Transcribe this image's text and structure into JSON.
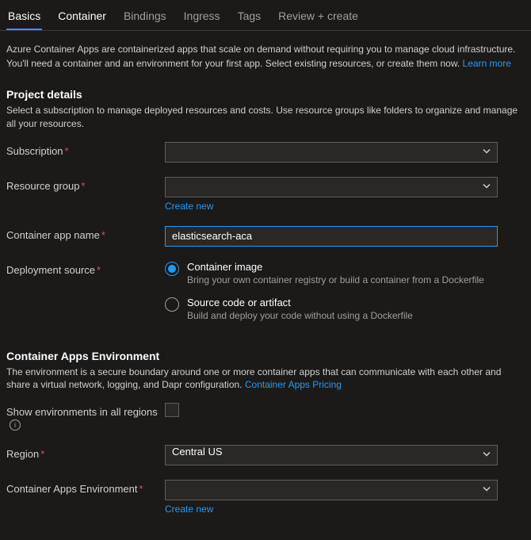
{
  "tabs": {
    "basics": "Basics",
    "container": "Container",
    "bindings": "Bindings",
    "ingress": "Ingress",
    "tags": "Tags",
    "review": "Review + create"
  },
  "intro": {
    "text": "Azure Container Apps are containerized apps that scale on demand without requiring you to manage cloud infrastructure. You'll need a container and an environment for your first app. Select existing resources, or create them now.",
    "learn_more": "Learn more"
  },
  "project": {
    "title": "Project details",
    "desc": "Select a subscription to manage deployed resources and costs. Use resource groups like folders to organize and manage all your resources."
  },
  "subscription": {
    "label": "Subscription",
    "value": " "
  },
  "resource_group": {
    "label": "Resource group",
    "value": " ",
    "create_new": "Create new"
  },
  "app_name": {
    "label": "Container app name",
    "value": "elasticsearch-aca"
  },
  "deployment_source": {
    "label": "Deployment source",
    "option1_title": "Container image",
    "option1_sub": "Bring your own container registry or build a container from a Dockerfile",
    "option2_title": "Source code or artifact",
    "option2_sub": "Build and deploy your code without using a Dockerfile"
  },
  "env": {
    "title": "Container Apps Environment",
    "desc": "The environment is a secure boundary around one or more container apps that can communicate with each other and share a virtual network, logging, and Dapr configuration.",
    "pricing_link": "Container Apps Pricing"
  },
  "show_envs": {
    "label": "Show environments in all regions"
  },
  "region": {
    "label": "Region",
    "value": "Central US"
  },
  "environment": {
    "label": "Container Apps Environment",
    "value": " ",
    "create_new": "Create new"
  }
}
